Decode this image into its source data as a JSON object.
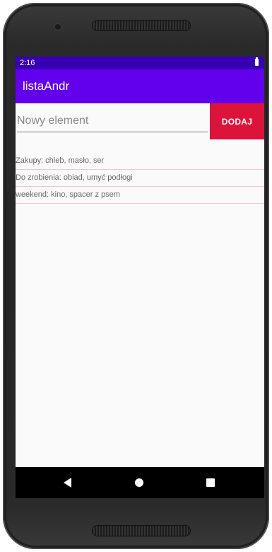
{
  "status_bar": {
    "time": "2:16",
    "icons": [
      "battery-icon"
    ]
  },
  "app_bar": {
    "title": "listaAndr",
    "color": "#6200ee",
    "status_color": "#3700b3"
  },
  "input": {
    "placeholder": "Nowy element",
    "value": ""
  },
  "add_button": {
    "label": "DODAJ",
    "color": "#dc143c"
  },
  "list": {
    "items": [
      {
        "text": "Zakupy: chleb, masło, ser"
      },
      {
        "text": "Do zrobienia: obiad, umyć podłogi"
      },
      {
        "text": "weekend: kino, spacer z psem"
      }
    ]
  },
  "nav_bar": {
    "icons": [
      "back-icon",
      "home-icon",
      "recents-icon"
    ]
  }
}
